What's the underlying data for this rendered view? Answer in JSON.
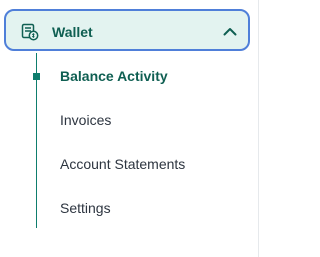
{
  "sidebar": {
    "section": {
      "label": "Wallet",
      "icon": "wallet-receipt-icon",
      "state_icon": "chevron-up-icon",
      "expanded": true
    },
    "items": [
      {
        "label": "Balance Activity",
        "active": true
      },
      {
        "label": "Invoices",
        "active": false
      },
      {
        "label": "Account Statements",
        "active": false
      },
      {
        "label": "Settings",
        "active": false
      }
    ]
  },
  "colors": {
    "accent": "#0e7d6d",
    "accent_text": "#0f5f52",
    "header_bg": "#e3f3f0",
    "focus_border": "#4f7fd9",
    "text": "#2d3540"
  }
}
